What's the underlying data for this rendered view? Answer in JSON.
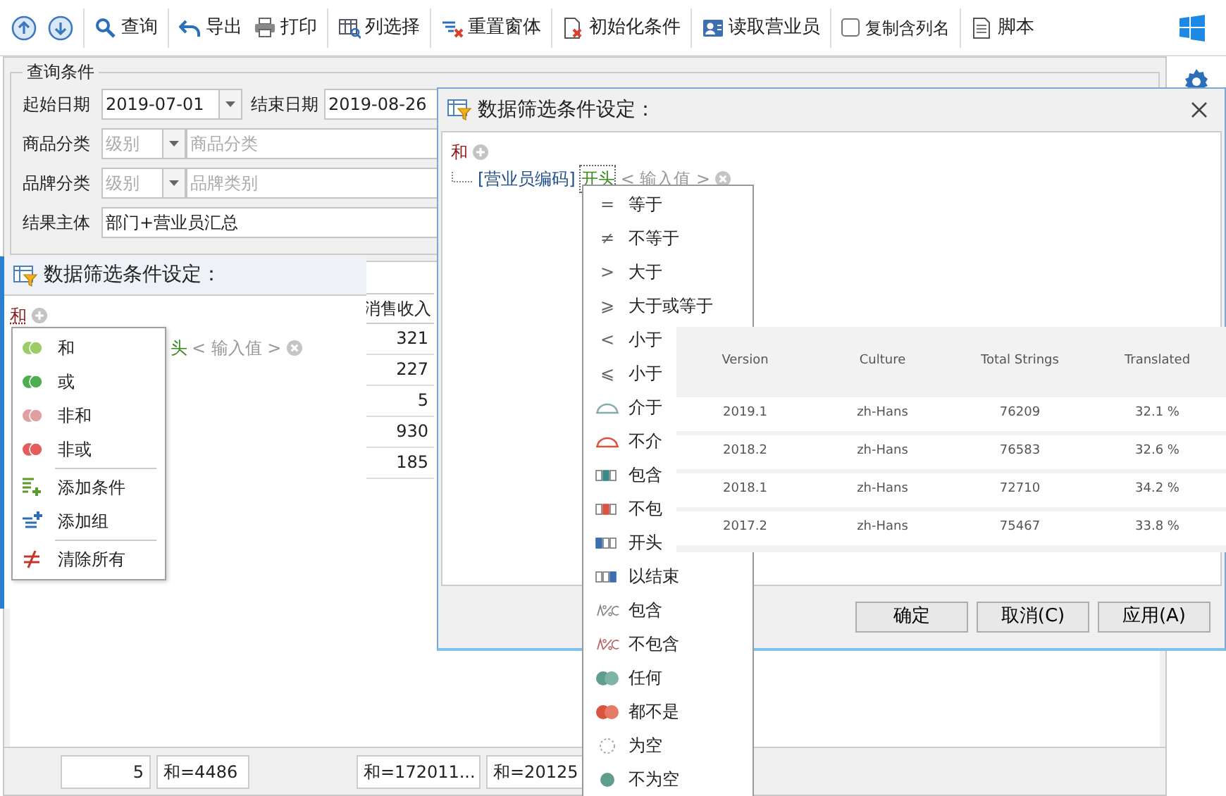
{
  "toolbar": {
    "items": [
      {
        "kind": "button",
        "label": "查询"
      },
      {
        "kind": "button",
        "label": "导出"
      },
      {
        "kind": "button",
        "label": "打印"
      },
      {
        "kind": "button",
        "label": "列选择"
      },
      {
        "kind": "button",
        "label": "重置窗体"
      },
      {
        "kind": "button",
        "label": "初始化条件"
      },
      {
        "kind": "button",
        "label": "读取营业员"
      },
      {
        "kind": "checkbox",
        "label": "复制含列名",
        "checked": false
      },
      {
        "kind": "button",
        "label": "脚本"
      }
    ]
  },
  "query_panel": {
    "title": "查询条件",
    "fields": [
      {
        "kind": "date-range",
        "label": "起始日期",
        "value": "2019-07-01",
        "end_label": "结束日期",
        "end_value": "2019-08-26"
      },
      {
        "kind": "category",
        "label": "商品分类",
        "level_placeholder": "级别",
        "placeholder": "商品分类"
      },
      {
        "kind": "category",
        "label": "品牌分类",
        "level_placeholder": "级别",
        "placeholder": "品牌类别"
      },
      {
        "kind": "text",
        "label": "结果主体",
        "value": "部门+营业员汇总"
      }
    ]
  },
  "grid": {
    "columns": [
      "消售收入"
    ],
    "rows": [
      [
        "321"
      ],
      [
        "227"
      ],
      [
        "5"
      ],
      [
        "930"
      ],
      [
        "185"
      ]
    ]
  },
  "status_bar": {
    "cells": [
      "5",
      "和=4486",
      "和=172011...",
      "和=20125"
    ]
  },
  "left_dialog": {
    "title": "数据筛选条件设定：",
    "tree": {
      "operator": "和",
      "condition": {
        "operator": "头",
        "value_placeholder": "< 输入值 >"
      }
    },
    "context_menu": [
      {
        "kind": "group",
        "label": "和",
        "color": "#9ccc65"
      },
      {
        "kind": "group",
        "label": "或",
        "color": "#4caf50"
      },
      {
        "kind": "group",
        "label": "非和",
        "color": "#e0a0a0"
      },
      {
        "kind": "group",
        "label": "非或",
        "color": "#e35d5d"
      },
      {
        "kind": "separator"
      },
      {
        "kind": "add-condition",
        "label": "添加条件"
      },
      {
        "kind": "add-group",
        "label": "添加组"
      },
      {
        "kind": "separator"
      },
      {
        "kind": "clear",
        "label": "清除所有"
      }
    ]
  },
  "right_dialog": {
    "title": "数据筛选条件设定：",
    "tree": {
      "operator": "和",
      "condition": {
        "field": "[营业员编码]",
        "operator": "开头",
        "value_placeholder": "< 输入值 >"
      }
    },
    "buttons": [
      "确定",
      "取消(C)",
      "应用(A)"
    ]
  },
  "operator_menu": [
    {
      "kind": "symbol",
      "symbol": "=",
      "label": "等于"
    },
    {
      "kind": "symbol",
      "symbol": "≠",
      "label": "不等于"
    },
    {
      "kind": "symbol",
      "symbol": ">",
      "label": "大于"
    },
    {
      "kind": "symbol",
      "symbol": "⩾",
      "label": "大于或等于"
    },
    {
      "kind": "symbol",
      "symbol": "<",
      "label": "小于"
    },
    {
      "kind": "symbol",
      "symbol": "⩽",
      "label": "小于"
    },
    {
      "kind": "between",
      "label": "介于"
    },
    {
      "kind": "not-between",
      "label": "不介"
    },
    {
      "kind": "contains",
      "label": "包含"
    },
    {
      "kind": "not-contains",
      "label": "不包"
    },
    {
      "kind": "starts",
      "label": "开头"
    },
    {
      "kind": "ends",
      "label": "以结束"
    },
    {
      "kind": "like",
      "label": "包含"
    },
    {
      "kind": "not-like",
      "label": "不包含"
    },
    {
      "kind": "any",
      "label": "任何"
    },
    {
      "kind": "none",
      "label": "都不是"
    },
    {
      "kind": "null",
      "label": "为空"
    },
    {
      "kind": "not-null",
      "label": "不为空"
    }
  ],
  "overlay_table": {
    "columns": [
      "Version",
      "Culture",
      "Total Strings",
      "Translated"
    ],
    "rows": [
      [
        "2019.1",
        "zh-Hans",
        "76209",
        "32.1 %"
      ],
      [
        "2018.2",
        "zh-Hans",
        "76583",
        "32.6 %"
      ],
      [
        "2018.1",
        "zh-Hans",
        "72710",
        "34.2 %"
      ],
      [
        "2017.2",
        "zh-Hans",
        "75467",
        "33.8 %"
      ]
    ]
  }
}
